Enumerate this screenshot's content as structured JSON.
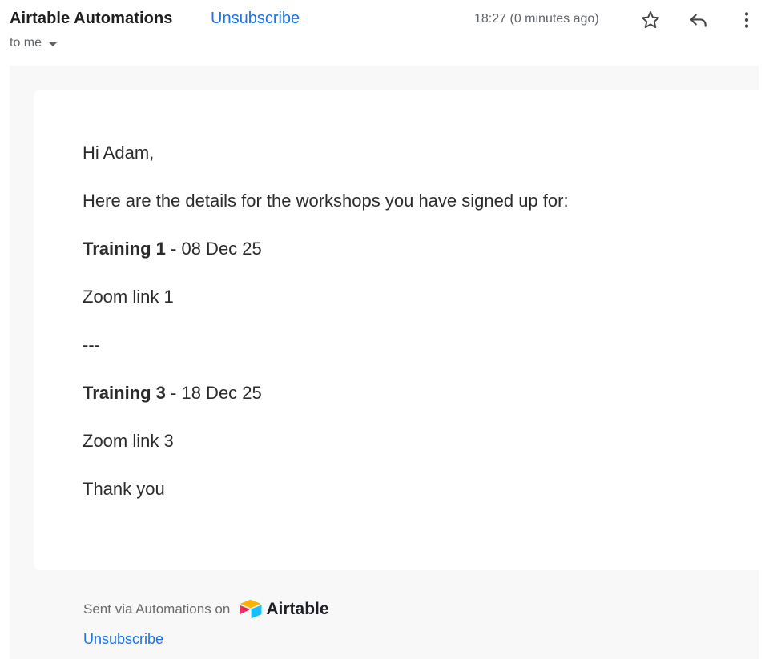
{
  "header": {
    "sender_name": "Airtable Automations",
    "unsubscribe_label": "Unsubscribe",
    "recipient_label": "to me",
    "timestamp": "18:27 (0 minutes ago)"
  },
  "icons": {
    "star": "star-icon",
    "reply": "reply-icon",
    "more": "more-vert-icon",
    "dropdown": "chevron-down-icon",
    "logo": "airtable-logo-icon"
  },
  "message": {
    "greeting": "Hi Adam,",
    "intro": "Here are the details for the workshops you have signed up for:",
    "workshops": [
      {
        "title": "Training 1",
        "date_suffix": " - 08 Dec 25",
        "link": "Zoom link 1"
      },
      {
        "title": "Training 3",
        "date_suffix": " - 18 Dec 25",
        "link": "Zoom link 3"
      }
    ],
    "separator": "---",
    "closing": "Thank you"
  },
  "footer": {
    "sent_via": "Sent via Automations on",
    "brand": "Airtable",
    "unsubscribe_label": "Unsubscribe"
  },
  "colors": {
    "link": "#1a73e8",
    "text": "#2b2b2b",
    "muted": "#5f6368",
    "background": "#f8f8f8"
  }
}
